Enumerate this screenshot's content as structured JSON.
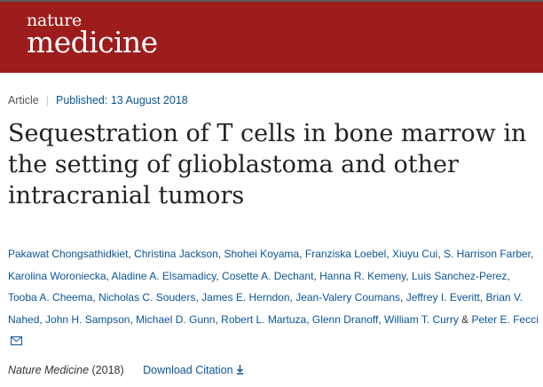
{
  "header": {
    "logo_top": "nature",
    "logo_bottom": "medicine",
    "bg_color": "#9d1c1c"
  },
  "meta": {
    "type": "Article",
    "published_label": "Published:",
    "published_date": "13 August 2018"
  },
  "title": "Sequestration of T cells in bone marrow in the setting of glioblastoma and other intracranial tumors",
  "authors": [
    "Pakawat Chongsathidkiet",
    "Christina Jackson",
    "Shohei Koyama",
    "Franziska Loebel",
    "Xiuyu Cui",
    "S. Harrison Farber",
    "Karolina Woroniecka",
    "Aladine A. Elsamadicy",
    "Cosette A. Dechant",
    "Hanna R. Kemeny",
    "Luis Sanchez-Perez",
    "Tooba A. Cheema",
    "Nicholas C. Souders",
    "James E. Herndon",
    "Jean-Valery Coumans",
    "Jeffrey I. Everitt",
    "Brian V. Nahed",
    "John H. Sampson",
    "Michael D. Gunn",
    "Robert L. Martuza",
    "Glenn Dranoff",
    "William T. Curry",
    "Peter E. Fecci"
  ],
  "citation": {
    "journal": "Nature Medicine",
    "year": "(2018)",
    "download_label": "Download Citation"
  },
  "icons": {
    "mail": "envelope-icon",
    "download": "download-arrow-icon"
  },
  "colors": {
    "link": "#0b5496",
    "text": "#222222"
  }
}
